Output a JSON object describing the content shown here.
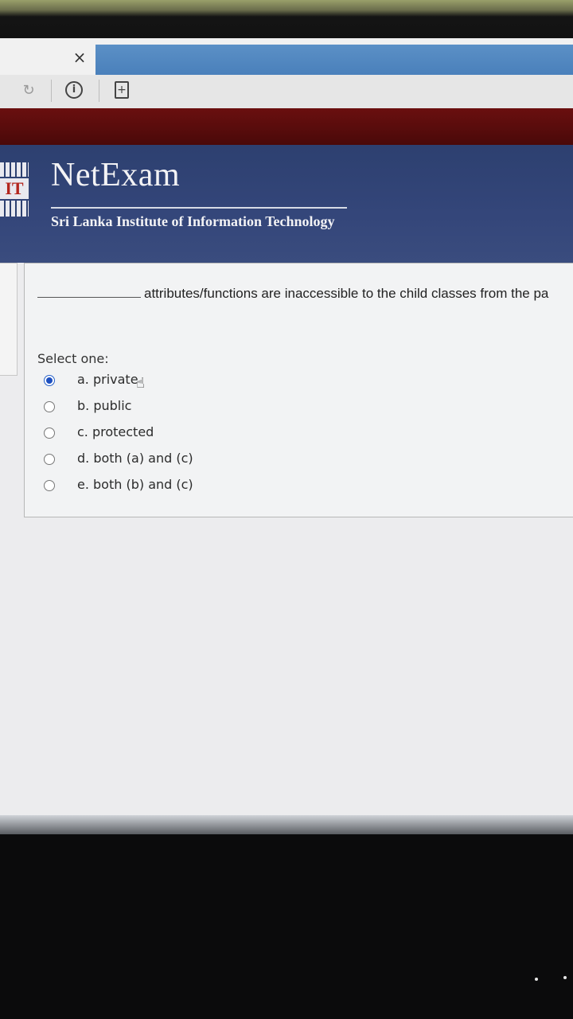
{
  "browser": {
    "tab_close_icon": "×",
    "toolbar_icons": [
      "reload-icon",
      "info-icon",
      "new-tab-icon"
    ]
  },
  "header": {
    "brand_title": "NetExam",
    "institution": "Sri Lanka Institute of Information Technology",
    "logo_text": "IT"
  },
  "question": {
    "text": "attributes/functions are inaccessible to the child classes from the pa",
    "select_label": "Select one:",
    "selected_index": 0,
    "options": [
      {
        "label": "a. private",
        "checked": true
      },
      {
        "label": "b. public",
        "checked": false
      },
      {
        "label": "c. protected",
        "checked": false
      },
      {
        "label": "d. both (a) and (c)",
        "checked": false
      },
      {
        "label": "e. both (b) and (c)",
        "checked": false
      }
    ]
  },
  "colors": {
    "header_bg": "#2d4070",
    "red_bar": "#5a0c0c",
    "accent_orange": "#e8802c",
    "radio_selected": "#1d4fbf"
  }
}
